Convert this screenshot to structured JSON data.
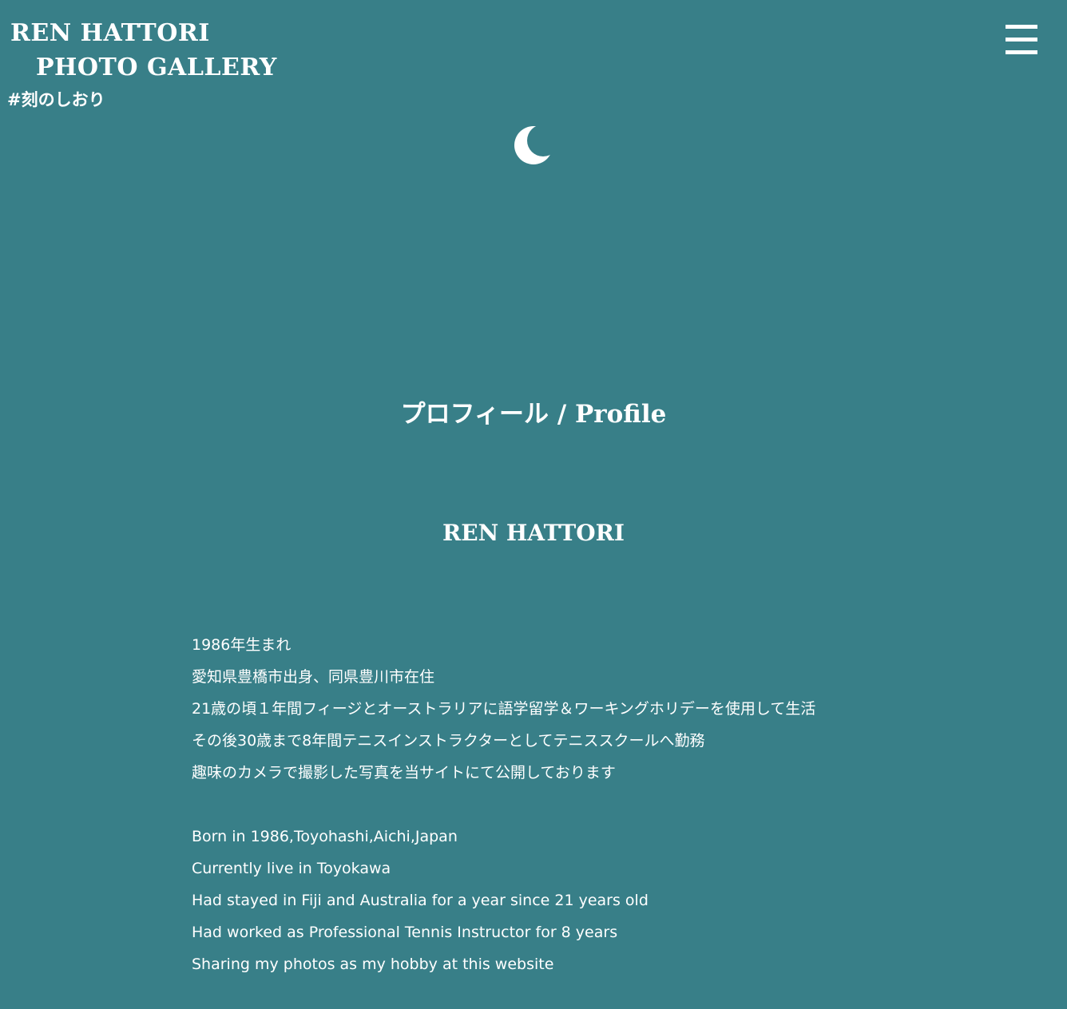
{
  "header": {
    "title_line1": "REN HATTORI",
    "title_line2": "PHOTO GALLERY",
    "tagline": "#刻のしおり",
    "menu_icon": "hamburger-menu-icon"
  },
  "hero": {
    "icon": "crescent-moon-icon"
  },
  "profile": {
    "section_title": "プロフィール / Profile",
    "name": "REN HATTORI",
    "bio_ja": [
      "1986年生まれ",
      "愛知県豊橋市出身、同県豊川市在住",
      "21歳の頃１年間フィージとオーストラリアに語学留学＆ワーキングホリデーを使用して生活",
      "その後30歳まで8年間テニスインストラクターとしてテニススクールへ勤務",
      "趣味のカメラで撮影した写真を当サイトにて公開しております"
    ],
    "bio_en": [
      "Born in 1986,Toyohashi,Aichi,Japan",
      "Currently live in Toyokawa",
      "Had stayed in Fiji and Australia for a year since 21 years old",
      "Had worked as Professional Tennis Instructor for 8 years",
      "Sharing my photos as my hobby at this website"
    ]
  },
  "colors": {
    "background": "#387f88",
    "text": "#ffffff"
  }
}
